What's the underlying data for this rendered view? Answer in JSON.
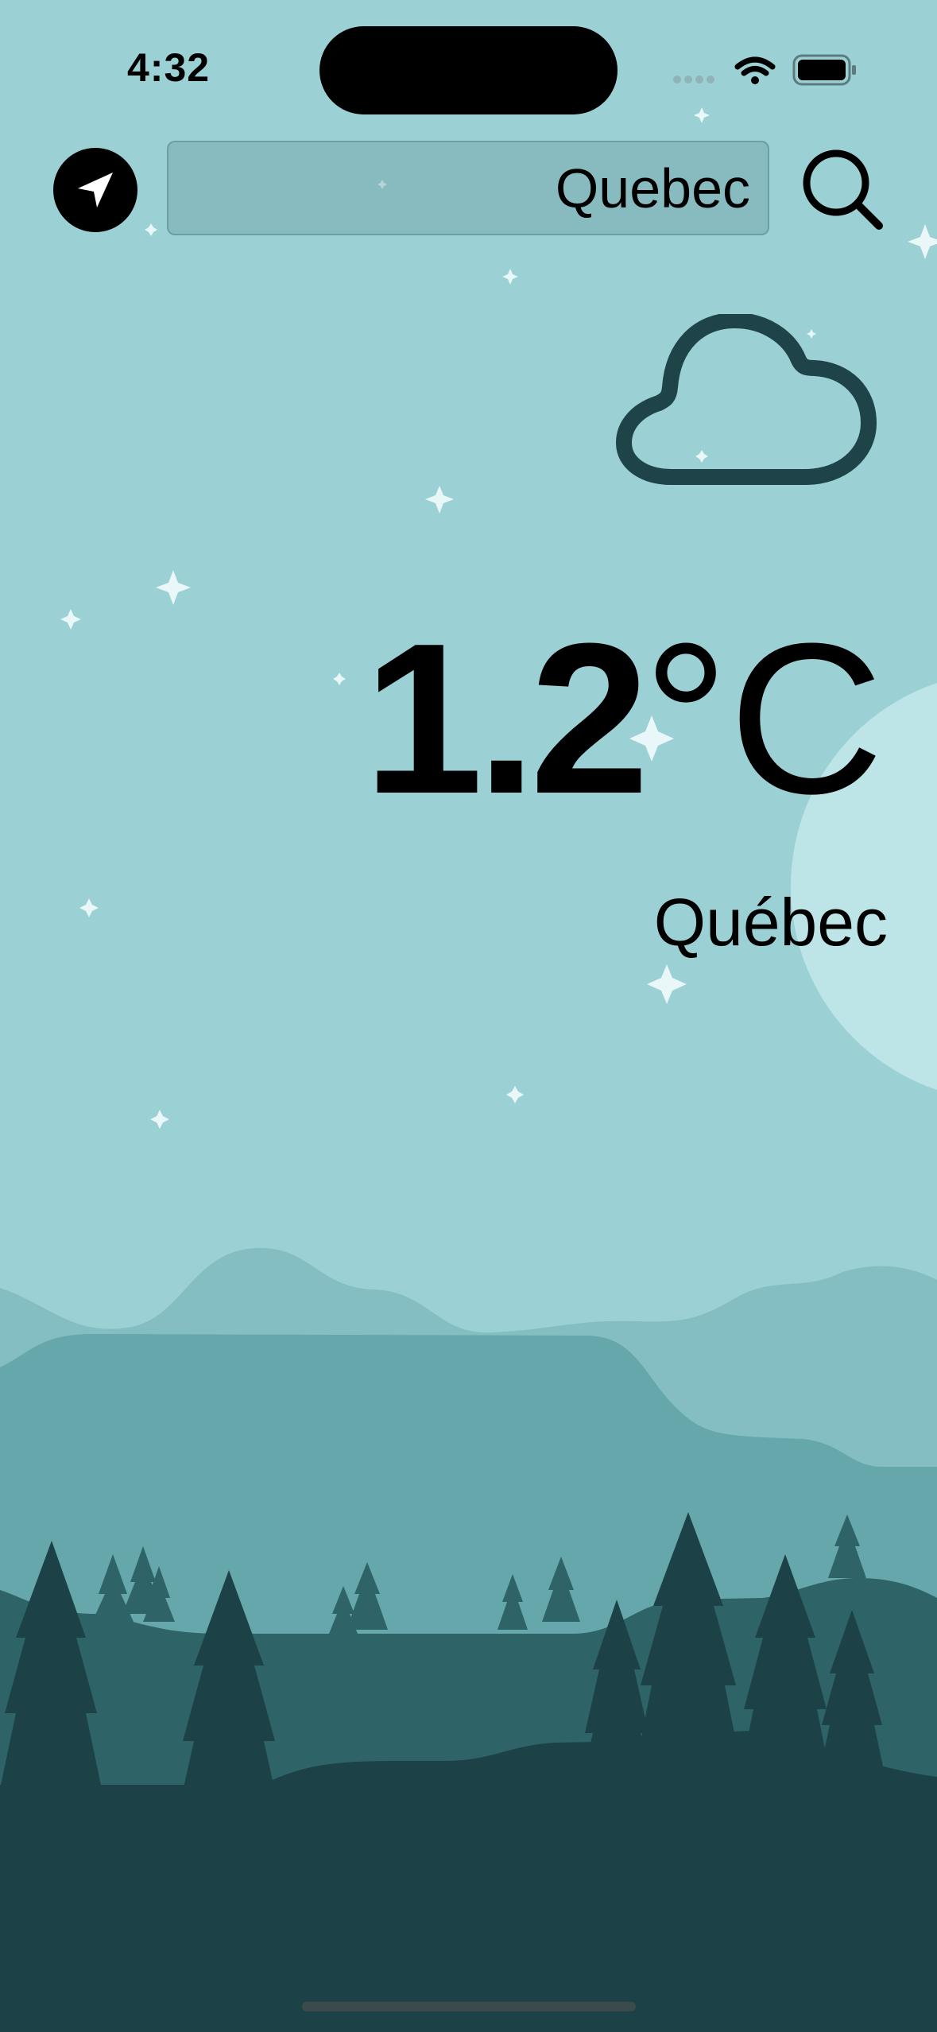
{
  "status_bar": {
    "time": "4:32"
  },
  "search": {
    "value": "Quebec",
    "placeholder": ""
  },
  "weather": {
    "temperature": "1.2",
    "unit": "°C",
    "city": "Québec",
    "condition_icon": "cloud-icon"
  },
  "icons": {
    "location": "location-arrow-icon",
    "search": "magnifier-icon"
  },
  "colors": {
    "sky": "#9BD0D4",
    "far_hills": "#85BEC2",
    "mid_hills": "#65A7AB",
    "near_hills": "#2E6367",
    "forest": "#1C4247",
    "moon": "#BDE4E6",
    "cloud_stroke": "#1E4449"
  }
}
